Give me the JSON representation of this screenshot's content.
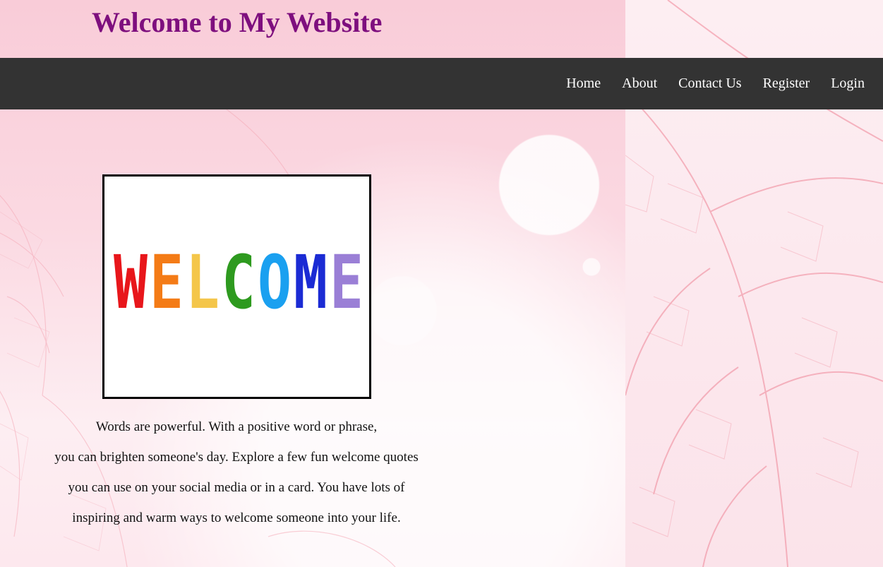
{
  "header": {
    "title": "Welcome to My Website"
  },
  "nav": {
    "items": [
      {
        "label": "Home"
      },
      {
        "label": "About"
      },
      {
        "label": "Contact Us"
      },
      {
        "label": "Register"
      },
      {
        "label": "Login"
      }
    ]
  },
  "hero": {
    "image_text": "WELCOME",
    "letter_colors": [
      "#e8161b",
      "#f47b16",
      "#f4c64a",
      "#2e9a1f",
      "#1aa0f0",
      "#1b2bd4",
      "#9a7fd6"
    ]
  },
  "intro": {
    "lines": [
      "Words are powerful. With a positive word or phrase,",
      "you can brighten someone's day. Explore a few fun welcome quotes",
      "you can use on your social media or in a card. You have lots of",
      "inspiring and warm ways to welcome someone into your life."
    ]
  },
  "colors": {
    "title": "#7e0f7e",
    "navbar": "#333333",
    "nav_text": "#ffffff",
    "background": "#fbdbe3"
  }
}
